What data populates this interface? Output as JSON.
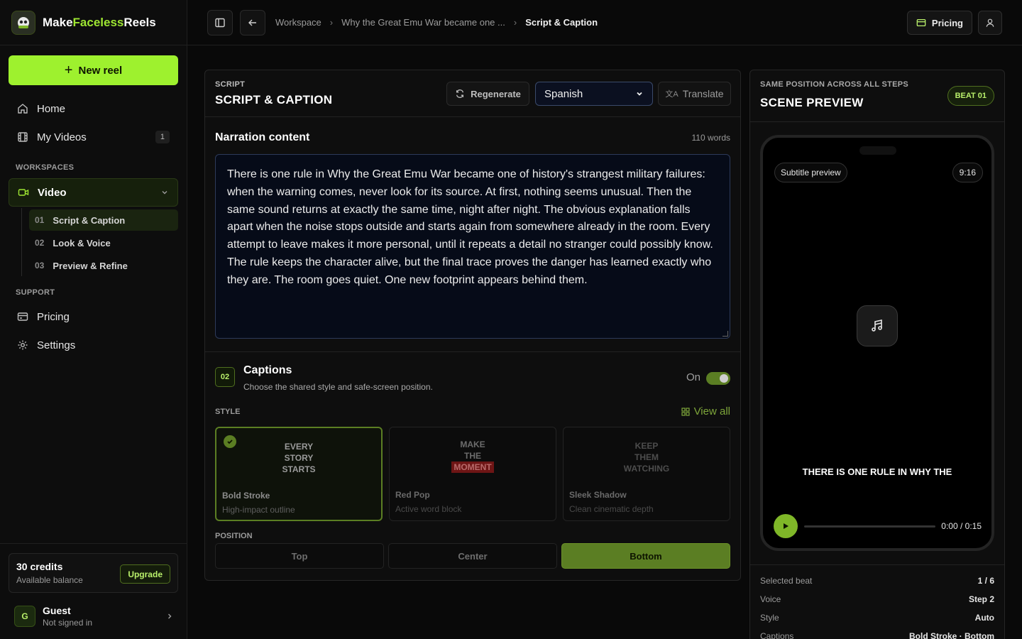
{
  "brand": {
    "prefix": "Make",
    "accent": "Faceless",
    "suffix": "Reels"
  },
  "sidebar": {
    "new_reel": "New reel",
    "items": [
      {
        "label": "Home",
        "icon": "home-icon"
      },
      {
        "label": "My Videos",
        "icon": "film-icon",
        "badge": "1"
      }
    ],
    "workspaces_label": "WORKSPACES",
    "workspace": {
      "label": "Video",
      "icon": "video-icon"
    },
    "steps": [
      {
        "num": "01",
        "label": "Script & Caption",
        "active": true
      },
      {
        "num": "02",
        "label": "Look & Voice",
        "active": false
      },
      {
        "num": "03",
        "label": "Preview & Refine",
        "active": false
      }
    ],
    "support_label": "SUPPORT",
    "support_items": [
      {
        "label": "Pricing",
        "icon": "credit-card-icon"
      },
      {
        "label": "Settings",
        "icon": "gear-icon"
      }
    ],
    "credits": {
      "title": "30 credits",
      "sub": "Available balance",
      "upgrade": "Upgrade"
    },
    "guest": {
      "initial": "G",
      "name": "Guest",
      "sub": "Not signed in"
    }
  },
  "topbar": {
    "crumbs": [
      "Workspace",
      "Why the Great Emu War became one ...",
      "Script & Caption"
    ],
    "pricing": "Pricing"
  },
  "script": {
    "eyebrow": "SCRIPT",
    "title": "SCRIPT & CAPTION",
    "regenerate": "Regenerate",
    "language": "Spanish",
    "translate": "Translate",
    "narration_title": "Narration content",
    "word_count": "110 words",
    "narration": "There is one rule in Why the Great Emu War became one of history's strangest military failures: when the warning comes, never look for its source. At first, nothing seems unusual. Then the same sound returns at exactly the same time, night after night. The obvious explanation falls apart when the noise stops outside and starts again from somewhere already in the room. Every attempt to leave makes it more personal, until it repeats a detail no stranger could possibly know. The rule keeps the character alive, but the final trace proves the danger has learned exactly who they are. The room goes quiet. One new footprint appears behind them."
  },
  "captions": {
    "num": "02",
    "title": "Captions",
    "sub": "Choose the shared style and safe-screen position.",
    "toggle_label": "On",
    "style_label": "STYLE",
    "view_all": "View all",
    "styles": [
      {
        "lines": [
          "EVERY",
          "STORY",
          "STARTS"
        ],
        "name": "Bold Stroke",
        "desc": "High-impact outline",
        "selected": true
      },
      {
        "lines": [
          "MAKE",
          "THE",
          "MOMENT"
        ],
        "name": "Red Pop",
        "desc": "Active word block",
        "selected": false
      },
      {
        "lines": [
          "KEEP",
          "THEM",
          "WATCHING"
        ],
        "name": "Sleek Shadow",
        "desc": "Clean cinematic depth",
        "selected": false
      }
    ],
    "position_label": "POSITION",
    "positions": [
      "Top",
      "Center",
      "Bottom"
    ],
    "selected_position": "Bottom"
  },
  "preview": {
    "eyebrow": "SAME POSITION ACROSS ALL STEPS",
    "title": "SCENE PREVIEW",
    "beat": "BEAT 01",
    "subtitle_chip": "Subtitle preview",
    "ratio": "9:16",
    "caption": "THERE IS ONE RULE IN WHY THE",
    "time": "0:00 / 0:15",
    "progress": 0,
    "meta": [
      {
        "k": "Selected beat",
        "v": "1 / 6"
      },
      {
        "k": "Voice",
        "v": "Step 2"
      },
      {
        "k": "Style",
        "v": "Auto"
      },
      {
        "k": "Captions",
        "v": "Bold Stroke · Bottom"
      }
    ]
  },
  "colors": {
    "accent": "#9ef12e",
    "accent_dark": "#5b7e23",
    "background": "#090909"
  }
}
